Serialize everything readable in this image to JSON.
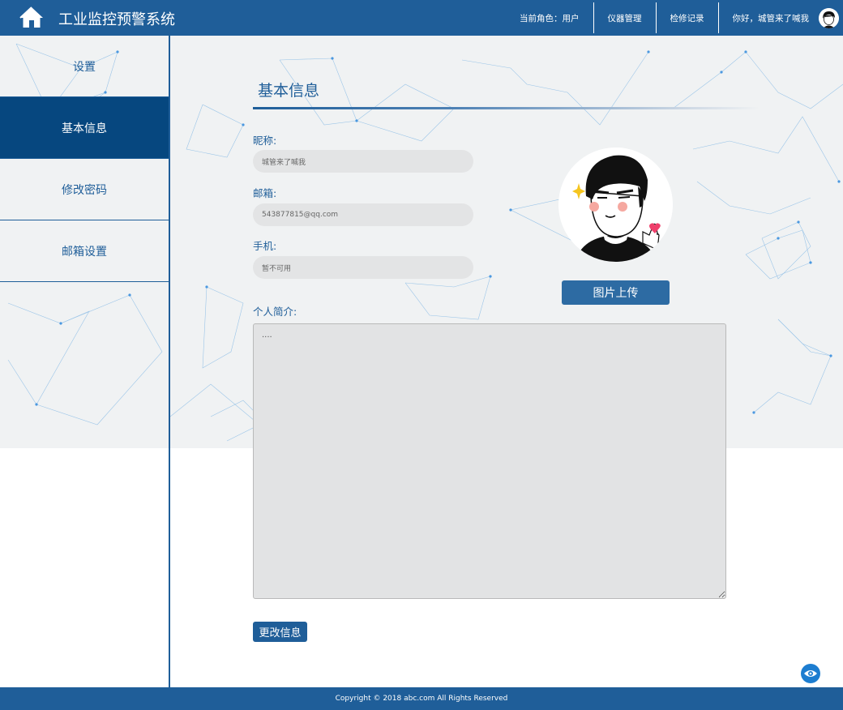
{
  "header": {
    "title": "工业监控预警系统",
    "nav": {
      "role": "当前角色：用户",
      "instruments": "仪器管理",
      "inspection": "检修记录",
      "greeting": "你好，城管来了喊我"
    }
  },
  "sidebar": {
    "items": [
      {
        "label": "设置"
      },
      {
        "label": "基本信息"
      },
      {
        "label": "修改密码"
      },
      {
        "label": "邮箱设置"
      }
    ]
  },
  "main": {
    "section_title": "基本信息",
    "nickname": {
      "label": "昵称:",
      "value": "城管来了喊我"
    },
    "email": {
      "label": "邮箱:",
      "value": "543877815@qq.com"
    },
    "phone": {
      "label": "手机:",
      "value": "暂不可用"
    },
    "bio": {
      "label": "个人简介:",
      "value": "...."
    },
    "upload_button": "图片上传",
    "submit_button": "更改信息"
  },
  "footer": {
    "copyright": "Copyright © 2018 abc.com All Rights Reserved"
  },
  "colors": {
    "primary": "#1f5e99",
    "sidebar_active": "#06477f",
    "band": "#f0f2f3",
    "input_bg": "#e3e4e5"
  },
  "icons": {
    "home": "home-icon",
    "avatar": "avatar-image",
    "eye": "eye-icon"
  }
}
